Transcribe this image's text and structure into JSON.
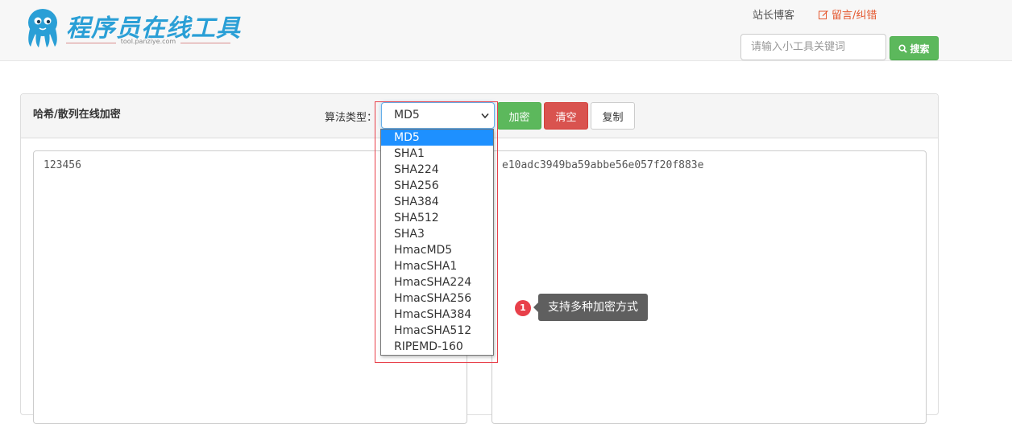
{
  "header": {
    "brand": "程序员在线工具",
    "subtitle": "tool.panziye.com",
    "blog_link": "站长博客",
    "message_link": "留言/纠错",
    "search_placeholder": "请输入小工具关键词",
    "search_button": "搜索"
  },
  "panel": {
    "title": "哈希/散列在线加密",
    "algo_label": "算法类型：",
    "selected_algo": "MD5",
    "encrypt_button": "加密",
    "clear_button": "清空",
    "copy_button": "复制",
    "input_text": "123456",
    "output_text": "e10adc3949ba59abbe56e057f20f883e"
  },
  "dropdown": {
    "options": [
      "MD5",
      "SHA1",
      "SHA224",
      "SHA256",
      "SHA384",
      "SHA512",
      "SHA3",
      "HmacMD5",
      "HmacSHA1",
      "HmacSHA224",
      "HmacSHA256",
      "HmacSHA384",
      "HmacSHA512",
      "RIPEMD-160"
    ]
  },
  "tip": {
    "badge": "1",
    "text": "支持多种加密方式"
  },
  "colors": {
    "brand_blue": "#2a9fd6",
    "success_green": "#5cb85c",
    "danger_red": "#d9534f",
    "highlight_red": "#e8404a",
    "selection_blue": "#1e90ff"
  }
}
